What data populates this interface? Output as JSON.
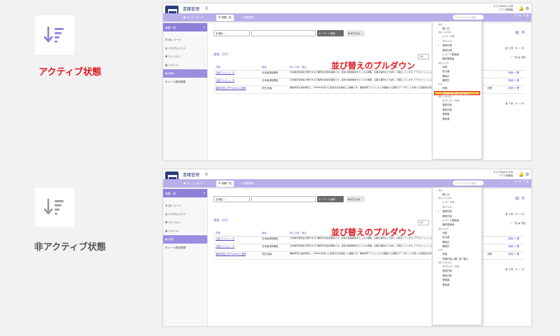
{
  "captions": {
    "active": "アクティブ状態",
    "inactive": "非アクティブ状態"
  },
  "annotation": "並び替えのプルダウン",
  "colors": {
    "active_icon": "#8e7fd8",
    "inactive_icon": "#9a9a9a",
    "caption_active": "#e0191f",
    "caption_inactive": "#555555",
    "accent": "#8e7fd8"
  },
  "icons": {
    "sort": "sort-descending-icon"
  },
  "app": {
    "title": "書籍管理",
    "subtitle": "画",
    "dashboard": "ダッシュボード",
    "user": "サステWorks お世",
    "role": "アプリ管理者",
    "tabs": [
      "書籍一覧",
      "+ 書籍登録"
    ],
    "search_placeholder": "エクスプラクから検索",
    "sidebar": {
      "head": "書籍一覧",
      "items": [
        {
          "label": "全レコード",
          "arrow": ""
        },
        {
          "label": "カスタムリスト",
          "arrow": "›"
        },
        {
          "label": "マイリスト",
          "arrow": "›"
        },
        {
          "label": "ジャンル",
          "arrow": "›"
        },
        {
          "label": "評価",
          "arrow": ""
        },
        {
          "label": "メール配信履歴",
          "arrow": ""
        }
      ]
    },
    "toolbar": {
      "select": "全項目",
      "keyword_btn": "キーワード検索",
      "filter_btn": "絞り込み"
    },
    "list_title": "書籍（3件）",
    "per_page": "20",
    "count": "全 3 件（1 ～ 3）",
    "view_toggle": "○ 一覧 ◉ 項目",
    "table": {
      "headers": [
        "書籍",
        "著者",
        "購入日時・理由",
        "",
        "",
        "",
        ""
      ],
      "rows": [
        {
          "title": "日経コンピュータ",
          "publisher": "日本経済新聞社",
          "desc": "日本経済新聞社が発行するIT業界の総合情報誌です。最新の技術動向やビジネス戦略、企業の事例などを詳しく報道しています。ITプロフェッショナル向けの情報が満載です。",
          "extra": "",
          "action": "詳細"
        },
        {
          "title": "日経コンピュータ",
          "publisher": "日本経済新聞社",
          "desc": "日本経済新聞社が発行するIT業界の総合情報誌です。最新の技術動向やビジネス戦略、企業の事例などを詳しく報道しています。ITプロフェッショナル向けの情報が満載です。",
          "extra": "",
          "action": "詳細"
        },
        {
          "title": "機械学習入門 Pythonと実践",
          "publisher": "村田 悠喜",
          "desc": "機械学習の基本概念と、Pythonを用いた実装方法を解説した書籍です。機械学習アルゴリズムの理論から実際のデータセットを用いた実践的な例まで、幅広くカバーしています。",
          "extra": "分野",
          "action": "詳細"
        }
      ]
    },
    "dropdown": [
      {
        "type": "group",
        "label": "書籍"
      },
      {
        "type": "item",
        "label": "購入日"
      },
      {
        "type": "group",
        "label": "書籍 基本情報"
      },
      {
        "type": "item",
        "label": "レコードID"
      },
      {
        "type": "item",
        "label": "タイトル"
      },
      {
        "type": "item",
        "label": "登録日時",
        "checked": true
      },
      {
        "type": "item",
        "label": "更新日時"
      },
      {
        "type": "item",
        "label": "レコード登録者"
      },
      {
        "type": "item",
        "label": "最終更新者"
      },
      {
        "type": "group",
        "label": "書籍の状態"
      },
      {
        "type": "item",
        "label": "状態"
      },
      {
        "type": "item",
        "label": "担当者"
      },
      {
        "type": "item",
        "label": "開始日"
      },
      {
        "type": "item",
        "label": "期限日"
      },
      {
        "type": "group",
        "label": "評価"
      },
      {
        "type": "item",
        "label": "評価"
      },
      {
        "type": "item",
        "label": "評価が高い順に並べ替え",
        "highlight_active": true
      },
      {
        "type": "group",
        "label": "書籍 基本情報"
      },
      {
        "type": "item",
        "label": "サブレコードID"
      },
      {
        "type": "item",
        "label": "登録日時"
      },
      {
        "type": "item",
        "label": "更新日時"
      },
      {
        "type": "item",
        "label": "登録者"
      },
      {
        "type": "item",
        "label": "更新者"
      }
    ]
  }
}
